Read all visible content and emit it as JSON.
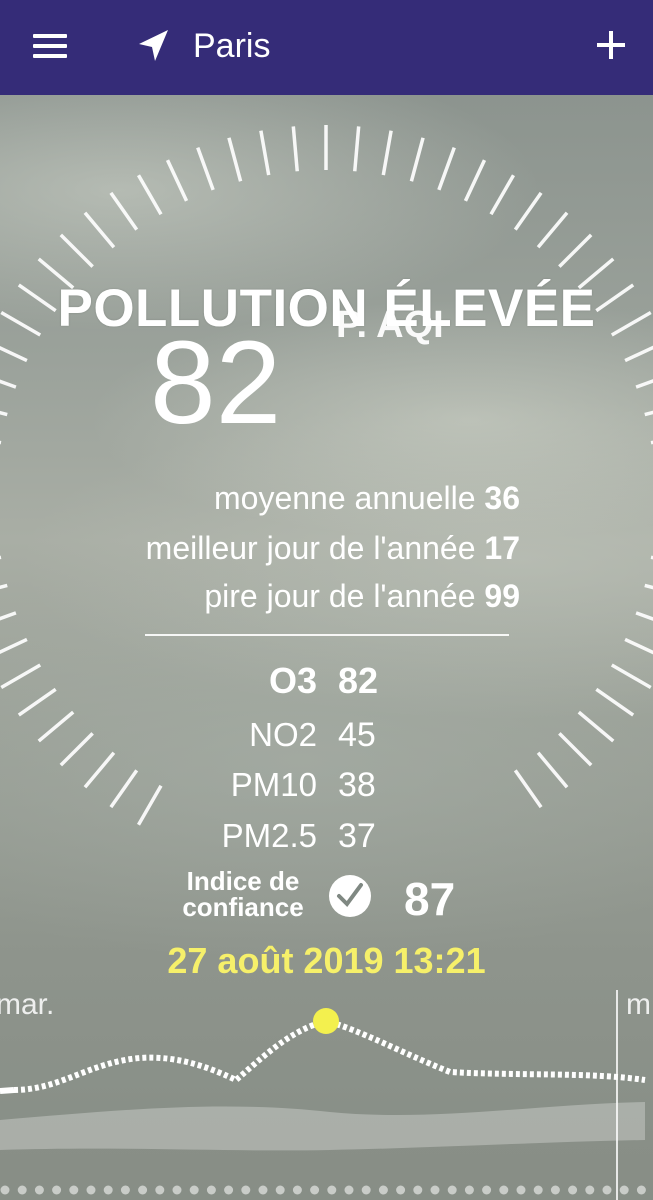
{
  "header": {
    "city": "Paris",
    "menu_icon": "hamburger-menu-icon",
    "location_icon": "navigation-arrow-icon",
    "add_icon": "plus-icon",
    "background": "#352c78"
  },
  "aqi": {
    "level": "POLLUTION ÉLEVÉE",
    "scale": "P. AQI",
    "value": "82"
  },
  "stats": [
    {
      "label": "moyenne annuelle",
      "value": "36"
    },
    {
      "label": "meilleur jour de l'année",
      "value": "17"
    },
    {
      "label": "pire jour de l'année",
      "value": "99"
    }
  ],
  "pollutants": [
    {
      "name": "O3",
      "value": "82",
      "dominant": true
    },
    {
      "name": "NO2",
      "value": "45",
      "dominant": false
    },
    {
      "name": "PM10",
      "value": "38",
      "dominant": false
    },
    {
      "name": "PM2.5",
      "value": "37",
      "dominant": false
    }
  ],
  "confidence": {
    "label": "Indice de confiance",
    "value": "87",
    "icon": "check-circle-icon"
  },
  "datetime": "27 août 2019 13:21",
  "datetime_color": "#f6f06a",
  "forecast": {
    "prev_day": "mar.",
    "next_day": "m",
    "marker_color": "#f3f04e",
    "page_dot_count": 38
  }
}
